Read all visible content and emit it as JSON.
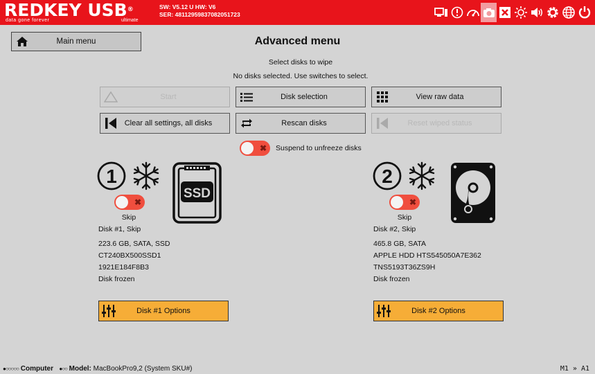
{
  "brand": {
    "name": "REDKEY USB",
    "reg": "®",
    "tagline": "data gone forever",
    "edition": "ultimate"
  },
  "version": {
    "line1": "SW: V5.12 U  HW: V6",
    "line2": "SER: 48112959837082051723"
  },
  "toolbar_icons": [
    "monitor-icon",
    "alert-icon",
    "speedometer-icon",
    "camera-icon",
    "close-box-icon",
    "brightness-icon",
    "volume-icon",
    "settings-icon",
    "globe-icon",
    "power-icon"
  ],
  "header": {
    "main_menu_label": "Main menu",
    "title": "Advanced menu"
  },
  "status": {
    "line1": "Select disks to wipe",
    "line2": "No disks selected. Use switches to select."
  },
  "buttons": {
    "start": "Start",
    "disk_selection": "Disk selection",
    "view_raw": "View raw data",
    "clear_all": "Clear all settings, all disks",
    "rescan": "Rescan disks",
    "reset_wiped": "Reset wiped status"
  },
  "suspend": {
    "label": "Suspend to unfreeze disks",
    "on": false
  },
  "disks": [
    {
      "number": "1",
      "icon": "SSD",
      "skip_label": "Skip",
      "title": "Disk #1, Skip",
      "details": [
        "223.6 GB, SATA, SSD",
        "CT240BX500SSD1",
        "1921E184F8B3",
        "Disk frozen"
      ],
      "options_label": "Disk #1 Options"
    },
    {
      "number": "2",
      "icon": "HDD",
      "skip_label": "Skip",
      "title": "Disk #2, Skip",
      "details": [
        "465.8 GB, SATA",
        "APPLE HDD HTS545050A7E362",
        "TNS5193T36ZS9H",
        "Disk frozen"
      ],
      "options_label": "Disk #2 Options"
    }
  ],
  "footer": {
    "computer_dots": "●○○○○○",
    "computer_label": "Computer",
    "model_dots": "●○○",
    "model_key": "Model:",
    "model_value": "MacBookPro9,2 (System SKU#)",
    "mode": "M1 » A1"
  },
  "colors": {
    "accent": "#e8141b",
    "option_button": "#f6ad37",
    "toggle_off": "#f04e3e",
    "background": "#d4d4d4"
  }
}
